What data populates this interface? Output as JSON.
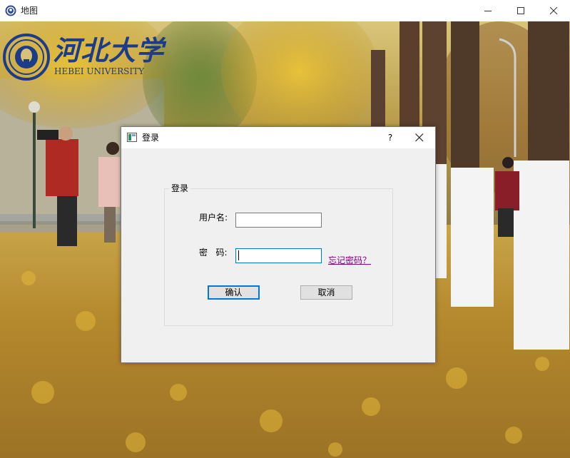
{
  "window": {
    "title": "地图"
  },
  "logo": {
    "name": "河北大学",
    "english": "HEBEI UNIVERSITY"
  },
  "dialog": {
    "title": "登录",
    "help_label": "?",
    "group_title": "登录",
    "username_label": "用户名:",
    "username_value": "",
    "password_label": "密   码:",
    "password_value": "",
    "forgot_link": "忘记密码？",
    "confirm_label": "确认",
    "cancel_label": "取消"
  },
  "colors": {
    "accent": "#0078d7",
    "link": "#800080",
    "logo": "#1c3b8a",
    "dialog_bg": "#f0f0f0"
  },
  "icons": {
    "app": "app-logo-icon",
    "minimize": "minimize-icon",
    "maximize": "maximize-icon",
    "close": "close-icon",
    "dialog": "dialog-window-icon"
  }
}
